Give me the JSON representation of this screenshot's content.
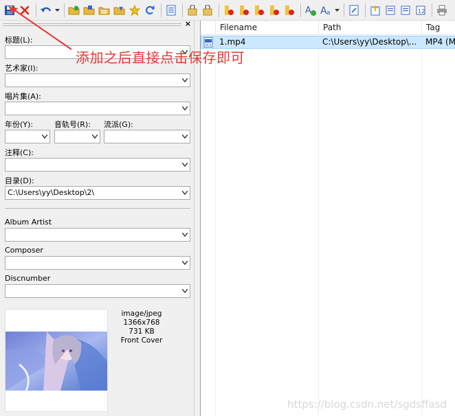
{
  "toolbar": {
    "buttons": [
      "save-icon",
      "remove-tag-icon",
      "undo-icon",
      "open-folder-icon",
      "add-folder-icon",
      "playlist-icon",
      "favorites-icon",
      "star-icon",
      "refresh-icon",
      "list-icon",
      "tag-from-filename-icon",
      "filename-from-tag-icon",
      "action-icon",
      "action2-icon",
      "action3-icon",
      "action4-icon",
      "action5-icon",
      "autofill-icon",
      "case-icon",
      "text-file-icon",
      "export-icon",
      "import-icon",
      "export2-icon",
      "numbering-icon",
      "print-icon"
    ]
  },
  "tag_panel": {
    "title_label": "标题(L):",
    "title_value": "",
    "artist_label": "艺术家(I):",
    "artist_value": "",
    "album_label": "唱片集(A):",
    "album_value": "",
    "year_label": "年份(Y):",
    "year_value": "",
    "track_label": "音轨号(R):",
    "track_value": "",
    "genre_label": "流派(G):",
    "genre_value": "",
    "comment_label": "注释(C):",
    "comment_value": "",
    "directory_label": "目录(D):",
    "directory_value": "C:\\Users\\yy\\Desktop\\2\\",
    "album_artist_label": "Album Artist",
    "album_artist_value": "",
    "composer_label": "Composer",
    "composer_value": "",
    "discnumber_label": "Discnumber",
    "discnumber_value": ""
  },
  "cover": {
    "mime": "image/jpeg",
    "dimensions": "1366x768",
    "size": "731 KB",
    "type": "Front Cover"
  },
  "file_list": {
    "columns": [
      "Filename",
      "Path",
      "Tag"
    ],
    "rows": [
      {
        "filename": "1.mp4",
        "path": "C:\\Users\\yy\\Desktop\\...",
        "tag": "MP4 (M"
      }
    ]
  },
  "annotation": {
    "text": "添加之后直接点击保存即可",
    "color": "#e53935"
  },
  "watermark": "https://blog.csdn.net/sgdsffasd",
  "colors": {
    "selection_bg": "#cce8ff",
    "selection_border": "#99d1ff",
    "toolbar_bg": "#f0f0f0"
  }
}
